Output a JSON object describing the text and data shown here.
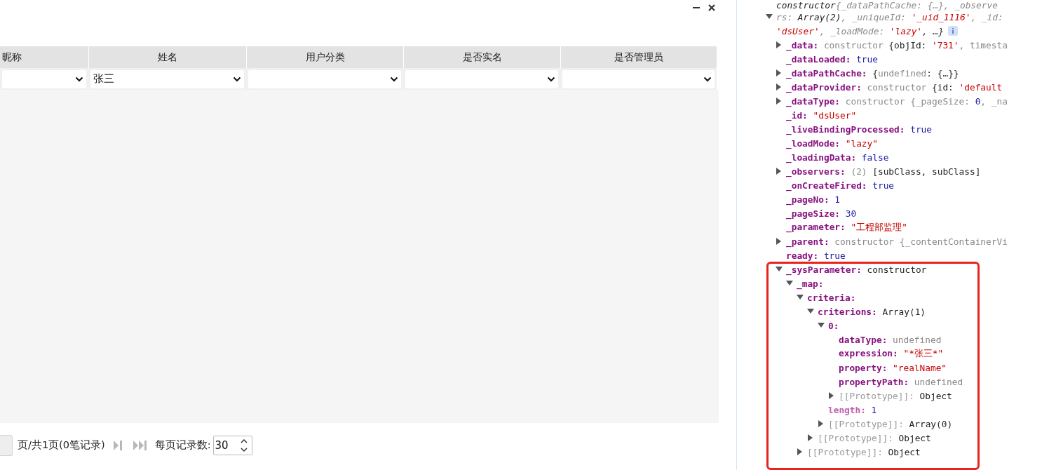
{
  "dialog": {
    "columns": [
      {
        "title": "昵称"
      },
      {
        "title": "姓名",
        "filter_value": "张三"
      },
      {
        "title": "用户分类"
      },
      {
        "title": "是否实名"
      },
      {
        "title": "是否管理员"
      }
    ],
    "pager": {
      "summary": "页/共1页(0笔记录)",
      "next_disabled": true,
      "last_disabled": true,
      "page_size_label": "每页记录数:",
      "page_size": "30"
    }
  },
  "devtools": {
    "object": {
      "expanded": true,
      "preview_lines": [
        [
          {
            "text": "constructor  ",
            "kind": "plain"
          },
          {
            "text": "{_dataPathCache: {…}, _observe",
            "kind": "faint"
          }
        ],
        [
          {
            "text": "rs: ",
            "kind": "faint"
          },
          {
            "text": "Array(2)",
            "kind": "plain"
          },
          {
            "text": ", _uniqueId: ",
            "kind": "faint"
          },
          {
            "text": "'_uid_1116'",
            "kind": "string"
          },
          {
            "text": ", _id:",
            "kind": "faint"
          }
        ],
        [
          {
            "text": "'dsUser'",
            "kind": "string"
          },
          {
            "text": ", _loadMode: ",
            "kind": "faint"
          },
          {
            "text": "'lazy'",
            "kind": "string"
          },
          {
            "text": ",  …}",
            "kind": "plain"
          }
        ]
      ],
      "children": [
        {
          "key": "_data:",
          "kind": "own",
          "expanded": false,
          "value": [
            {
              "text": "constructor  ",
              "kind": "faint"
            },
            {
              "text": "{objId: ",
              "kind": "plain"
            },
            {
              "text": "'731'",
              "kind": "string"
            },
            {
              "text": ", timesta",
              "kind": "faint"
            }
          ]
        },
        {
          "key": "_dataLoaded:",
          "kind": "own",
          "value": [
            {
              "text": "true",
              "kind": "keyword"
            }
          ]
        },
        {
          "key": "_dataPathCache:",
          "kind": "own",
          "expanded": false,
          "value": [
            {
              "text": "{",
              "kind": "plain"
            },
            {
              "text": "undefined",
              "kind": "faint"
            },
            {
              "text": ": {…}}",
              "kind": "plain"
            }
          ]
        },
        {
          "key": "_dataProvider:",
          "kind": "own",
          "expanded": false,
          "value": [
            {
              "text": "constructor  ",
              "kind": "faint"
            },
            {
              "text": "{id: ",
              "kind": "plain"
            },
            {
              "text": "'default",
              "kind": "string"
            }
          ]
        },
        {
          "key": "_dataType:",
          "kind": "own",
          "expanded": false,
          "value": [
            {
              "text": "constructor  ",
              "kind": "faint"
            },
            {
              "text": "{_pageSize: ",
              "kind": "faint"
            },
            {
              "text": "0",
              "kind": "number"
            },
            {
              "text": ", _na",
              "kind": "faint"
            }
          ]
        },
        {
          "key": "_id:",
          "kind": "own",
          "value": [
            {
              "text": "\"dsUser\"",
              "kind": "string"
            }
          ]
        },
        {
          "key": "_liveBindingProcessed:",
          "kind": "own",
          "value": [
            {
              "text": "true",
              "kind": "keyword"
            }
          ]
        },
        {
          "key": "_loadMode:",
          "kind": "own",
          "value": [
            {
              "text": "\"lazy\"",
              "kind": "string"
            }
          ]
        },
        {
          "key": "_loadingData:",
          "kind": "own",
          "value": [
            {
              "text": "false",
              "kind": "keyword"
            }
          ]
        },
        {
          "key": "_observers:",
          "kind": "own",
          "expanded": false,
          "value": [
            {
              "text": "(2)  ",
              "kind": "faint"
            },
            {
              "text": "[subClass, subClass]",
              "kind": "plain"
            }
          ]
        },
        {
          "key": "_onCreateFired:",
          "kind": "own",
          "value": [
            {
              "text": "true",
              "kind": "keyword"
            }
          ]
        },
        {
          "key": "_pageNo:",
          "kind": "own",
          "value": [
            {
              "text": "1",
              "kind": "number"
            }
          ]
        },
        {
          "key": "_pageSize:",
          "kind": "own",
          "value": [
            {
              "text": "30",
              "kind": "number"
            }
          ]
        },
        {
          "key": "_parameter:",
          "kind": "own",
          "value": [
            {
              "text": "\"工程部监理\"",
              "kind": "string"
            }
          ]
        },
        {
          "key": "_parent:",
          "kind": "own",
          "expanded": false,
          "value": [
            {
              "text": "constructor  ",
              "kind": "faint"
            },
            {
              "text": "{_contentContainerVi",
              "kind": "faint"
            }
          ]
        },
        {
          "key": "ready:",
          "kind": "own",
          "value": [
            {
              "text": "true",
              "kind": "keyword"
            }
          ]
        },
        {
          "key": "_sysParameter:",
          "kind": "own",
          "expanded": true,
          "value": [
            {
              "text": "constructor",
              "kind": "plain"
            }
          ],
          "children": [
            {
              "key": "_map:",
              "kind": "own",
              "expanded": true,
              "children": [
                {
                  "key": "criteria:",
                  "kind": "own",
                  "expanded": true,
                  "children": [
                    {
                      "key": "criterions:",
                      "kind": "own",
                      "expanded": true,
                      "value": [
                        {
                          "text": "Array(1)",
                          "kind": "plain"
                        }
                      ],
                      "children": [
                        {
                          "key": "0:",
                          "kind": "own",
                          "expanded": true,
                          "children": [
                            {
                              "key": "dataType:",
                              "kind": "own",
                              "value": [
                                {
                                  "text": "undefined",
                                  "kind": "faint"
                                }
                              ]
                            },
                            {
                              "key": "expression:",
                              "kind": "own",
                              "value": [
                                {
                                  "text": "\"*张三*\"",
                                  "kind": "string"
                                }
                              ]
                            },
                            {
                              "key": "property:",
                              "kind": "own",
                              "value": [
                                {
                                  "text": "\"realName\"",
                                  "kind": "string"
                                }
                              ]
                            },
                            {
                              "key": "propertyPath:",
                              "kind": "own",
                              "value": [
                                {
                                  "text": "undefined",
                                  "kind": "faint"
                                }
                              ]
                            },
                            {
                              "key": "[[Prototype]]:",
                              "kind": "proto",
                              "expanded": false,
                              "value": [
                                {
                                  "text": "Object",
                                  "kind": "plain"
                                }
                              ]
                            }
                          ]
                        },
                        {
                          "key": "length:",
                          "kind": "meta",
                          "value": [
                            {
                              "text": "1",
                              "kind": "number"
                            }
                          ]
                        },
                        {
                          "key": "[[Prototype]]:",
                          "kind": "proto",
                          "expanded": false,
                          "value": [
                            {
                              "text": "Array(0)",
                              "kind": "plain"
                            }
                          ]
                        }
                      ]
                    },
                    {
                      "key": "[[Prototype]]:",
                      "kind": "proto",
                      "expanded": false,
                      "value": [
                        {
                          "text": "Object",
                          "kind": "plain"
                        }
                      ]
                    }
                  ]
                },
                {
                  "key": "[[Prototype]]:",
                  "kind": "proto",
                  "expanded": false,
                  "value": [
                    {
                      "text": "Object",
                      "kind": "plain"
                    }
                  ]
                }
              ]
            }
          ]
        }
      ]
    }
  }
}
